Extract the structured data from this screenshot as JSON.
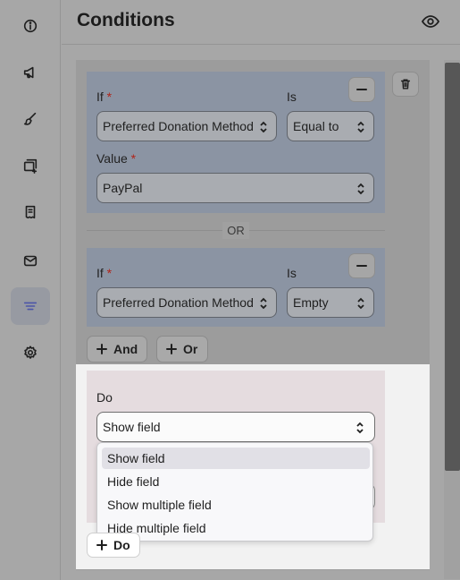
{
  "header": {
    "title": "Conditions",
    "preview_icon": "eye-icon"
  },
  "rail": {
    "items": [
      {
        "name": "info",
        "icon": "info-icon"
      },
      {
        "name": "marketing",
        "icon": "megaphone-icon"
      },
      {
        "name": "design",
        "icon": "paintbrush-icon"
      },
      {
        "name": "media",
        "icon": "gallery-add-icon"
      },
      {
        "name": "receipt",
        "icon": "receipt-icon"
      },
      {
        "name": "email",
        "icon": "mail-icon"
      },
      {
        "name": "conditions",
        "icon": "filter-lines-icon",
        "active": true
      },
      {
        "name": "settings",
        "icon": "gear-icon"
      }
    ]
  },
  "condition1": {
    "if_label": "If",
    "required_mark": "*",
    "is_label": "Is",
    "field_value": "Preferred Donation Method",
    "operator_value": "Equal to",
    "value_label": "Value",
    "value_value": "PayPal"
  },
  "or_separator": "OR",
  "condition2": {
    "if_label": "If",
    "required_mark": "*",
    "is_label": "Is",
    "field_value": "Preferred Donation Method",
    "operator_value": "Empty"
  },
  "buttons": {
    "and_label": "And",
    "or_label": "Or",
    "do_label": "Do"
  },
  "do_section": {
    "label": "Do",
    "selected": "Show field",
    "options": [
      "Show field",
      "Hide field",
      "Show multiple field",
      "Hide multiple field"
    ]
  },
  "colors": {
    "accent": "#4b55a8",
    "required": "#b0241a"
  }
}
